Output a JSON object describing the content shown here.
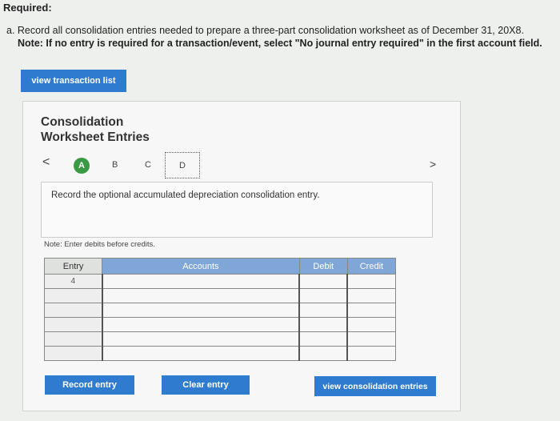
{
  "header": {
    "required": "Required:",
    "instruction": "a. Record all consolidation entries needed to prepare a three-part consolidation worksheet as of December 31, 20X8.",
    "note": "Note: If no entry is required for a transaction/event, select \"No journal entry required\" in the first account field."
  },
  "buttons": {
    "view_transaction_list": "view transaction list",
    "record_entry": "Record entry",
    "clear_entry": "Clear entry",
    "view_consolidation_entries": "view consolidation entries"
  },
  "panel": {
    "title_line1": "Consolidation",
    "title_line2": "Worksheet Entries",
    "nav_prev": "<",
    "nav_next": ">",
    "steps": [
      "A",
      "B",
      "C",
      "D"
    ],
    "active_step": "D",
    "description": "Record the optional accumulated depreciation consolidation entry.",
    "note": "Note: Enter debits before credits."
  },
  "table": {
    "headers": {
      "entry": "Entry",
      "accounts": "Accounts",
      "debit": "Debit",
      "credit": "Credit"
    },
    "rows": [
      {
        "entry": "4"
      },
      {
        "entry": ""
      },
      {
        "entry": ""
      },
      {
        "entry": ""
      },
      {
        "entry": ""
      },
      {
        "entry": ""
      }
    ]
  },
  "colors": {
    "button": "#2f7bcf",
    "header": "#7fa6d6",
    "active_step": "#3a9a44"
  }
}
